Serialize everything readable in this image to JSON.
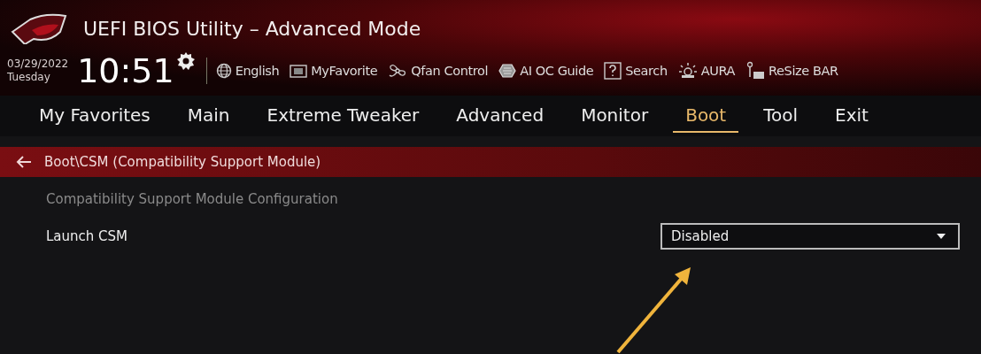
{
  "window": {
    "title": "UEFI BIOS Utility – Advanced Mode"
  },
  "clock": {
    "date": "03/29/2022",
    "day": "Tuesday",
    "time": "10:51"
  },
  "toolbar": [
    {
      "kind": "globe",
      "label": "English"
    },
    {
      "kind": "favorite",
      "label": "MyFavorite"
    },
    {
      "kind": "fan",
      "label": "Qfan Control"
    },
    {
      "kind": "chip",
      "label": "AI OC Guide"
    },
    {
      "kind": "help",
      "label": "Search"
    },
    {
      "kind": "light",
      "label": "AURA"
    },
    {
      "kind": "resize",
      "label": "ReSize BAR"
    }
  ],
  "tabs": [
    {
      "label": "My Favorites",
      "selected": false
    },
    {
      "label": "Main",
      "selected": false
    },
    {
      "label": "Extreme Tweaker",
      "selected": false
    },
    {
      "label": "Advanced",
      "selected": false
    },
    {
      "label": "Monitor",
      "selected": false
    },
    {
      "label": "Boot",
      "selected": true
    },
    {
      "label": "Tool",
      "selected": false
    },
    {
      "label": "Exit",
      "selected": false
    }
  ],
  "breadcrumb": "Boot\\CSM (Compatibility Support Module)",
  "section_heading": "Compatibility Support Module Configuration",
  "settings": [
    {
      "label": "Launch CSM",
      "value": "Disabled"
    }
  ]
}
